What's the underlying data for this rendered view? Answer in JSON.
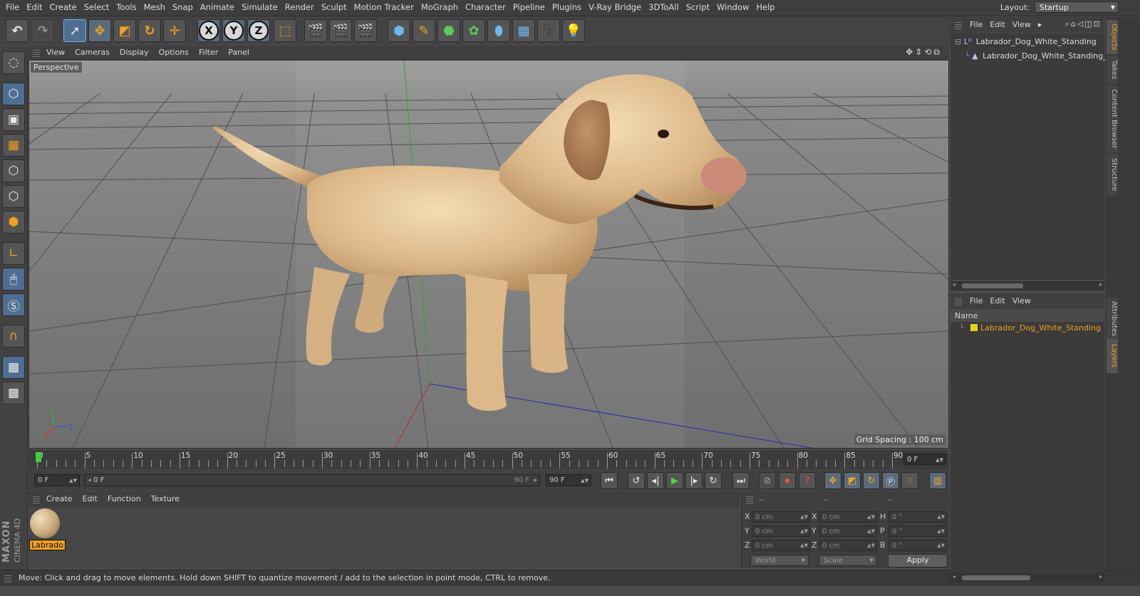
{
  "menubar": {
    "items": [
      "File",
      "Edit",
      "Create",
      "Select",
      "Tools",
      "Mesh",
      "Snap",
      "Animate",
      "Simulate",
      "Render",
      "Sculpt",
      "Motion Tracker",
      "MoGraph",
      "Character",
      "Pipeline",
      "Plugins",
      "V-Ray Bridge",
      "3DToAll",
      "Script",
      "Window",
      "Help"
    ],
    "layout_label": "Layout:",
    "layout_value": "Startup"
  },
  "toolbar": {
    "undo_icon": "undo-icon",
    "redo_icon": "redo-icon",
    "x_label": "X",
    "y_label": "Y",
    "z_label": "Z"
  },
  "viewport": {
    "menus": [
      "View",
      "Cameras",
      "Display",
      "Options",
      "Filter",
      "Panel"
    ],
    "camera_label": "Perspective",
    "grid_label": "Grid Spacing : 100 cm",
    "axis_labels": {
      "y": "Y",
      "z": "Z",
      "x": "X"
    }
  },
  "timeline": {
    "ticks": [
      "0",
      "5",
      "10",
      "15",
      "20",
      "25",
      "30",
      "35",
      "40",
      "45",
      "50",
      "55",
      "60",
      "65",
      "70",
      "75",
      "80",
      "85",
      "90"
    ],
    "current_frame": "0 F"
  },
  "playback": {
    "start_field": "0 F",
    "range_start": "0 F",
    "range_end": "90 F",
    "end_field": "90 F"
  },
  "material_manager": {
    "menus": [
      "Create",
      "Edit",
      "Function",
      "Texture"
    ],
    "material_name": "Labrado"
  },
  "coordinates": {
    "header_cols": [
      "--",
      "--",
      "--"
    ],
    "rows": [
      {
        "l1": "X",
        "v1": "0 cm",
        "l2": "X",
        "v2": "0 cm",
        "l3": "H",
        "v3": "0 °"
      },
      {
        "l1": "Y",
        "v1": "0 cm",
        "l2": "Y",
        "v2": "0 cm",
        "l3": "P",
        "v3": "0 °"
      },
      {
        "l1": "Z",
        "v1": "0 cm",
        "l2": "Z",
        "v2": "0 cm",
        "l3": "B",
        "v3": "0 °"
      }
    ],
    "space_select": "World",
    "mode_select": "Scale",
    "apply_label": "Apply"
  },
  "status_text": "Move: Click and drag to move elements. Hold down SHIFT to quantize movement / add to the selection in point mode, CTRL to remove.",
  "brand": {
    "line1": "MAXON",
    "line2": "CINEMA 4D"
  },
  "objects_panel": {
    "menus": [
      "File",
      "Edit",
      "View"
    ],
    "items": [
      "Labrador_Dog_White_Standing",
      "Labrador_Dog_White_Standing_"
    ]
  },
  "layers_panel": {
    "menus": [
      "File",
      "Edit",
      "View"
    ],
    "column_name": "Name",
    "layer_name": "Labrador_Dog_White_Standing",
    "layer_color": "#e8d020"
  },
  "right_tabs": [
    "Objects",
    "Takes",
    "Content Browser",
    "Structure",
    "Attributes",
    "Layers"
  ],
  "colors": {
    "accent": "#f0a020",
    "selection": "#4f6f92"
  }
}
